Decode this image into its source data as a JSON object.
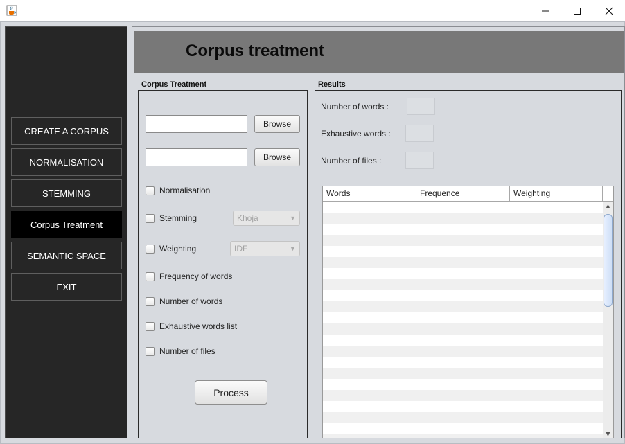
{
  "window": {
    "icon": "java-cup-icon",
    "controls": {
      "minimize": "—",
      "maximize": "☐",
      "close": "✕"
    }
  },
  "sidebar": {
    "items": [
      {
        "label": "CREATE A CORPUS"
      },
      {
        "label": "NORMALISATION"
      },
      {
        "label": "STEMMING"
      },
      {
        "label": "Corpus Treatment",
        "active": true
      },
      {
        "label": "SEMANTIC SPACE"
      },
      {
        "label": "EXIT"
      }
    ]
  },
  "header": {
    "title": "Corpus treatment"
  },
  "corpus_panel": {
    "title": "Corpus Treatment",
    "input1": {
      "value": "",
      "browse_label": "Browse"
    },
    "input2": {
      "value": "",
      "browse_label": "Browse"
    },
    "options": [
      {
        "label": "Normalisation",
        "checked": false
      },
      {
        "label": "Stemming",
        "checked": false,
        "combo": "Khoja"
      },
      {
        "label": "Weighting",
        "checked": false,
        "combo": "IDF"
      },
      {
        "label": "Frequency of words",
        "checked": false
      },
      {
        "label": "Number of words",
        "checked": false
      },
      {
        "label": "Exhaustive words list",
        "checked": false
      },
      {
        "label": "Number of files",
        "checked": false
      }
    ],
    "process_label": "Process"
  },
  "results_panel": {
    "title": "Results",
    "number_of_words": {
      "label": "Number of words :",
      "value": ""
    },
    "exhaustive_words": {
      "label": "Exhaustive words :",
      "value": ""
    },
    "number_of_files": {
      "label": "Number of files :",
      "value": ""
    },
    "table": {
      "columns": [
        "Words",
        "Frequence",
        "Weighting"
      ],
      "rows": []
    },
    "scrollbar": {
      "up": "▲",
      "down": "▼"
    }
  },
  "colors": {
    "sidebar_bg": "#262626",
    "active_item": "#000000",
    "header_bg": "#787878",
    "panel_bg": "#d7dadf"
  }
}
